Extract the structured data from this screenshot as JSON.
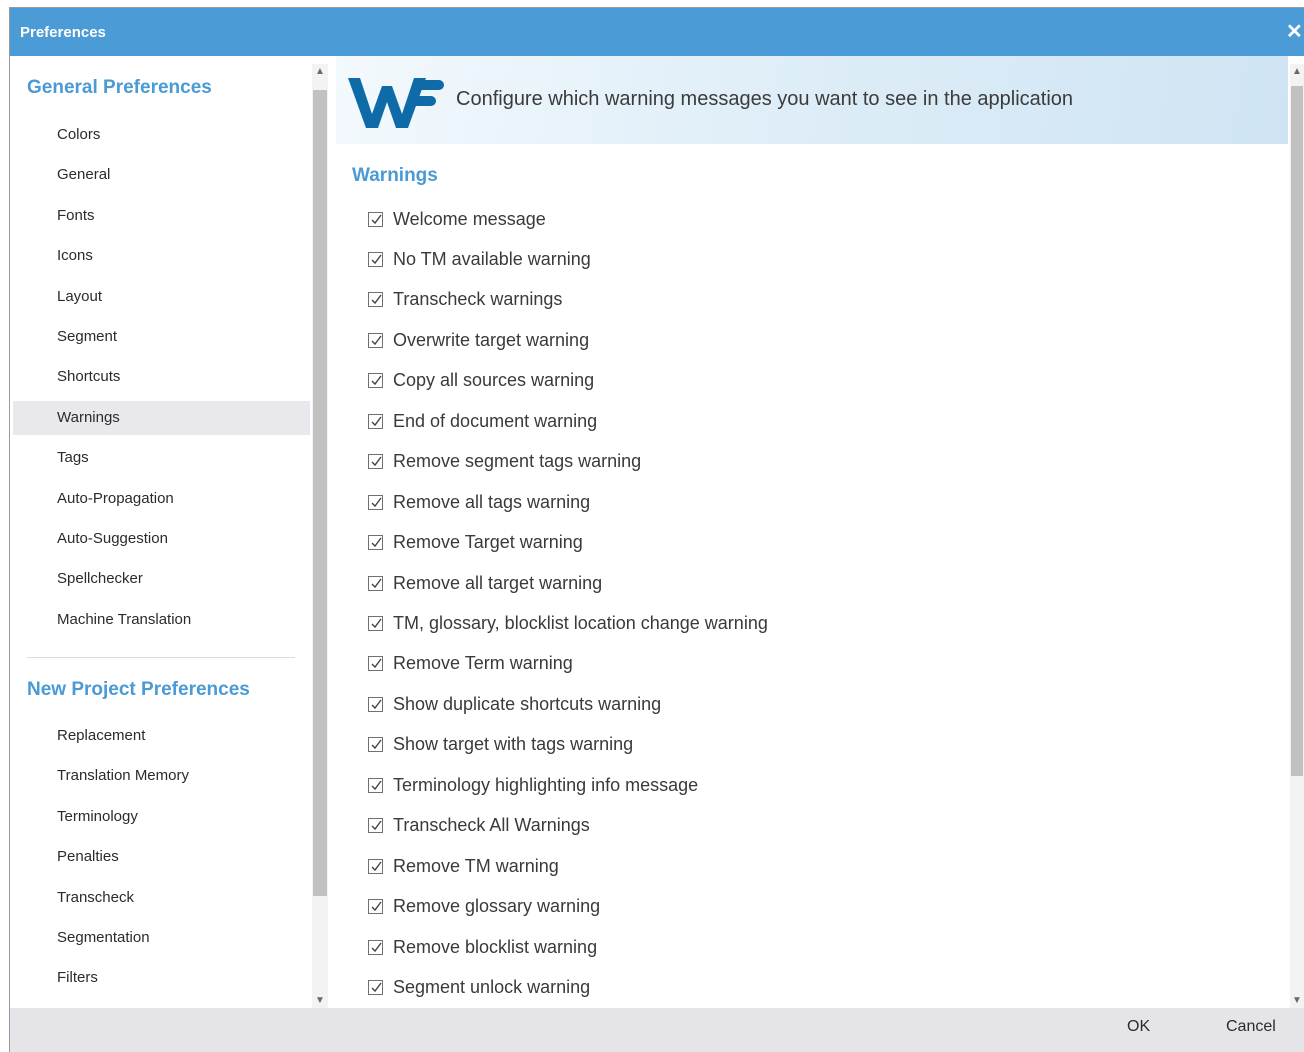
{
  "window": {
    "title": "Preferences",
    "close_icon": "close-icon"
  },
  "sidebar": {
    "general_title": "General Preferences",
    "general_items": [
      "Colors",
      "General",
      "Fonts",
      "Icons",
      "Layout",
      "Segment",
      "Shortcuts",
      "Warnings",
      "Tags",
      "Auto-Propagation",
      "Auto-Suggestion",
      "Spellchecker",
      "Machine Translation"
    ],
    "active_item": "Warnings",
    "project_title": "New Project Preferences",
    "project_items": [
      "Replacement",
      "Translation Memory",
      "Terminology",
      "Penalties",
      "Transcheck",
      "Segmentation",
      "Filters"
    ]
  },
  "banner": {
    "logo_icon": "wf-logo",
    "headline": "Configure which warning messages you want to see in the application"
  },
  "warnings": {
    "title": "Warnings",
    "items": [
      {
        "label": "Welcome message",
        "checked": true
      },
      {
        "label": "No TM available warning",
        "checked": true
      },
      {
        "label": "Transcheck warnings",
        "checked": true
      },
      {
        "label": "Overwrite target warning",
        "checked": true
      },
      {
        "label": "Copy all sources warning",
        "checked": true
      },
      {
        "label": "End of document warning",
        "checked": true
      },
      {
        "label": "Remove segment tags warning",
        "checked": true
      },
      {
        "label": "Remove all tags warning",
        "checked": true
      },
      {
        "label": "Remove Target warning",
        "checked": true
      },
      {
        "label": "Remove all target warning",
        "checked": true
      },
      {
        "label": "TM, glossary, blocklist location change warning",
        "checked": true
      },
      {
        "label": "Remove Term warning",
        "checked": true
      },
      {
        "label": "Show duplicate shortcuts warning",
        "checked": true
      },
      {
        "label": "Show target with tags warning",
        "checked": true
      },
      {
        "label": "Terminology highlighting info message",
        "checked": true
      },
      {
        "label": "Transcheck All Warnings",
        "checked": true
      },
      {
        "label": "Remove TM warning",
        "checked": true
      },
      {
        "label": "Remove glossary warning",
        "checked": true
      },
      {
        "label": "Remove blocklist warning",
        "checked": true
      },
      {
        "label": "Segment unlock warning",
        "checked": true
      }
    ]
  },
  "footer": {
    "ok_label": "OK",
    "cancel_label": "Cancel"
  },
  "colors": {
    "accent": "#4a9ad6",
    "titlebar": "#4b9bd6",
    "footer": "#e5e5e9",
    "active_item": "#e9e9ed"
  }
}
